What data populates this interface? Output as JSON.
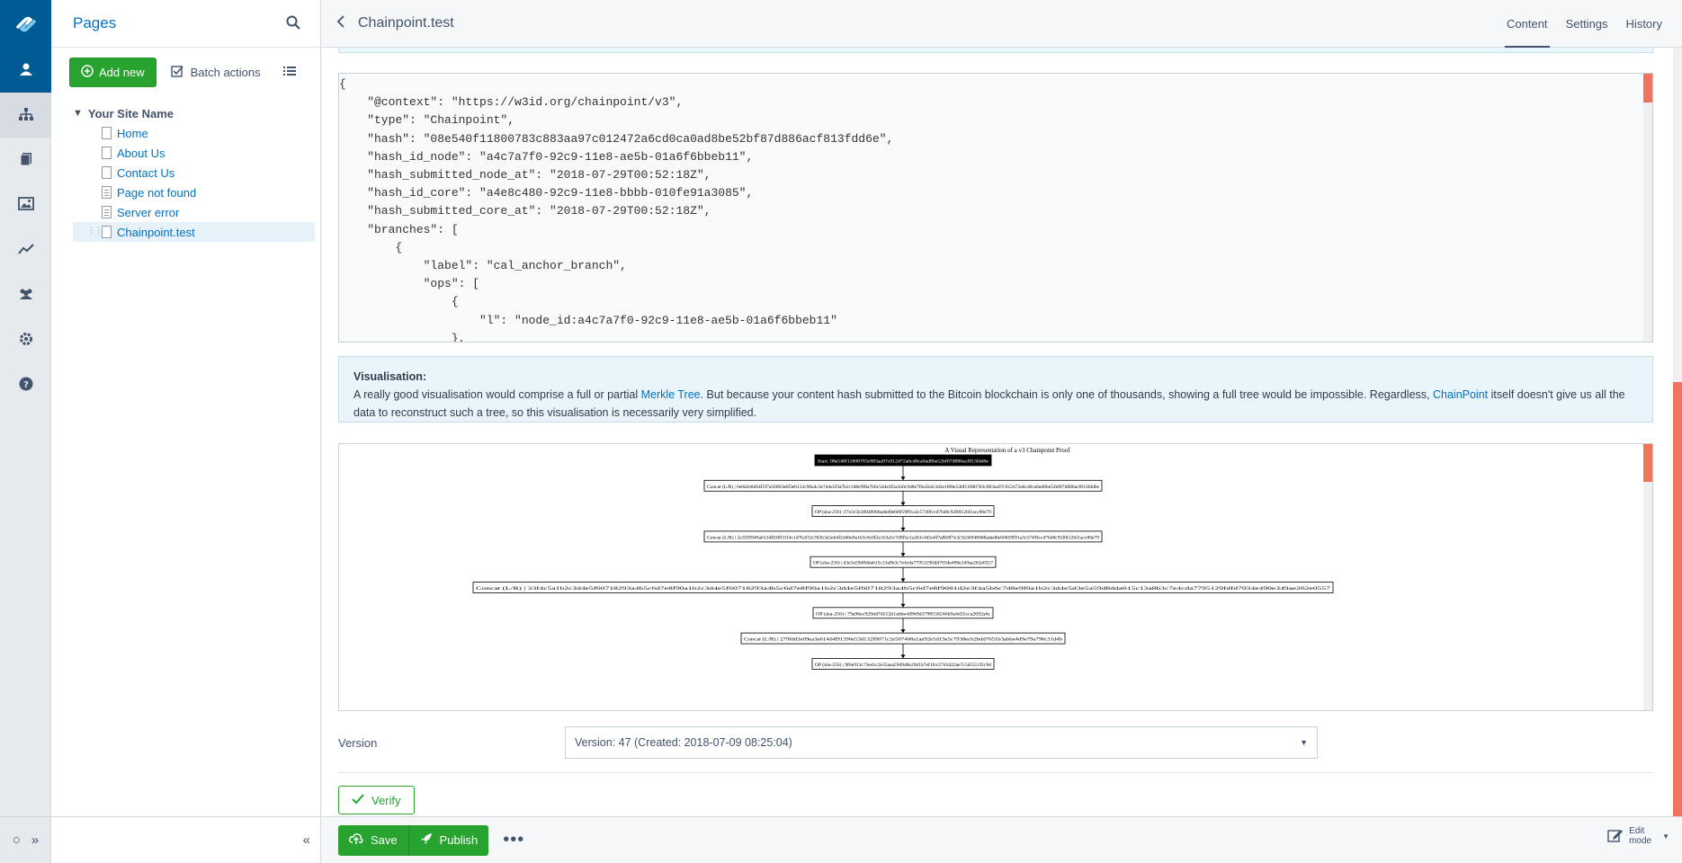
{
  "sidebar": {
    "icons": [
      "site-tree-icon",
      "files-icon",
      "images-icon",
      "reports-icon",
      "security-icon",
      "settings-icon",
      "help-icon"
    ]
  },
  "tree": {
    "title": "Pages",
    "add_label": "Add new",
    "batch_label": "Batch actions",
    "root_label": "Your Site Name",
    "pages": [
      {
        "label": "Home"
      },
      {
        "label": "About Us"
      },
      {
        "label": "Contact Us"
      },
      {
        "label": "Page not found"
      },
      {
        "label": "Server error"
      },
      {
        "label": "Chainpoint.test"
      }
    ]
  },
  "header": {
    "breadcrumb": "Chainpoint.test",
    "tabs": [
      {
        "label": "Content"
      },
      {
        "label": "Settings"
      },
      {
        "label": "History"
      }
    ]
  },
  "proof_json": "{\n    \"@context\": \"https://w3id.org/chainpoint/v3\",\n    \"type\": \"Chainpoint\",\n    \"hash\": \"08e540f11800783c883aa97c012472a6cd0ca0ad8be52bf87d886acf813fdd6e\",\n    \"hash_id_node\": \"a4c7a7f0-92c9-11e8-ae5b-01a6f6bbeb11\",\n    \"hash_submitted_node_at\": \"2018-07-29T00:52:18Z\",\n    \"hash_id_core\": \"a4e8c480-92c9-11e8-bbbb-010fe91a3085\",\n    \"hash_submitted_core_at\": \"2018-07-29T00:52:18Z\",\n    \"branches\": [\n        {\n            \"label\": \"cal_anchor_branch\",\n            \"ops\": [\n                {\n                    \"l\": \"node_id:a4c7a7f0-92c9-11e8-ae5b-01a6f6bbeb11\"\n                },",
  "visualisation": {
    "heading": "Visualisation:",
    "text_1": "A really good visualisation would comprise a full or partial ",
    "link_1": "Merkle Tree",
    "text_2": ". But because your content hash submitted to the Bitcoin blockchain is only one of thousands, showing a full tree would be impossible. Regardless, ",
    "link_2": "ChainPoint",
    "text_3": " itself doesn't give us all the data to reconstruct such a tree, so this visualisation is necessarily very simplified.",
    "diagram_title": "A Visual Representation of a v3 Chainpoint Proof",
    "nodes": [
      {
        "label": "Start: 08e540f11800783c883aa97c012472a6cd0ca0ad8be52bf87d886acf813fdd6e"
      },
      {
        "label": "Concat (L/R) | 6e0d2e8d94f5f7a56803a6f3e6133c98a4c3e7d4e5f3a7b2c1d0e9f8a7b6c5d4e3f2a1b0c9d8e7f6a5b4c3d2e1f08e540f11800783c883aa97c012472a6cd0ca0ad8be52bf87d886acf813fdd6e"
      },
      {
        "label": "OP (sha-256) | f7e3c5b36948068aded0e60059f91a3c5749fccd7648c92f0f12bf1acc80e79"
      },
      {
        "label": "Concat (L/R) | 2e359f949a6134f03f031f4c1d7b2f32c9f2b3e5e64f2d40e0a1b3c8c0f2e1b3a5c7d9f5e1a2b3c4d5e6f7a8b9f7e3c5b36948068aded0e60059f91a3c5749fccd7648c92f0f12bf1acc80e79"
      },
      {
        "label": "OP (sha-256) | d3e5a59d8dda615c13a8b3c7e4cda7795129fdfd7034e490e349ae262e0557"
      },
      {
        "label": "Concat (L/R) | 33f4c5a1b2c3d4e5f60718293a4b5c6d7e8f90a1b2c3d4e5f60718293a4b5c6d7e8f90a1b2c3d4e5f60718293a4b5c6d7e8f9081d2e3f4a5b6c7d8e9f0a1b2c3d4e5d3e5a59d8dda615c13a8b3c7e4cda7795129fdfd7034e490e349ae262e0557"
      },
      {
        "label": "OP (sha-256) | 79a96ec929dd7d512b1abbe4d969d3798558246b9a4d35cca2092a6c"
      },
      {
        "label": "Concat (L/R) | 279fdd3e09ea3e614d4f91396e53d132f0071c2e507468a1ae92e5d13e5c7938ecb2bdd7651b3abbe4d9e79a796c31d4b"
      },
      {
        "label": "OP (sha-256) | 9f6e913c73ed1c2e35aaa59d9d8e29d1b7ef1fcc27d1d22ae7c5d5551f1c9d"
      }
    ]
  },
  "version": {
    "label": "Version",
    "value": "Version: 47 (Created: 2018-07-09 08:25:04)"
  },
  "actions": {
    "verify_label": "Verify",
    "save_label": "Save",
    "publish_label": "Publish",
    "edit_mode_line1": "Edit",
    "edit_mode_line2": "mode"
  },
  "colors": {
    "brand": "#005b94",
    "primary_button": "#29a32f",
    "link": "#0071c4",
    "scroll_thumb": "#f0745c"
  }
}
